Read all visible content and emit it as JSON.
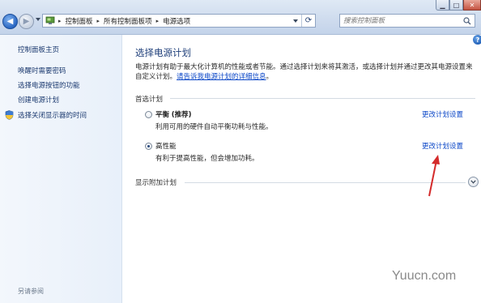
{
  "window": {
    "minimize_icon": "minimize-icon",
    "maximize_icon": "maximize-icon",
    "close_icon": "close-icon"
  },
  "addressbar": {
    "crumbs": [
      "控制面板",
      "所有控制面板项",
      "电源选项"
    ],
    "separator": "▸",
    "refresh_icon": "refresh-icon"
  },
  "search": {
    "placeholder": "搜索控制面板",
    "icon": "search-icon"
  },
  "sidebar": {
    "home": "控制面板主页",
    "links": [
      "唤醒时需要密码",
      "选择电源按钮的功能",
      "创建电源计划",
      "选择关闭显示器的时间"
    ],
    "see_also": "另请参阅"
  },
  "main": {
    "title": "选择电源计划",
    "description_text": "电源计划有助于最大化计算机的性能或者节能。通过选择计划来将其激活，或选择计划并通过更改其电源设置来自定义计划。",
    "description_link": "请告诉我电源计划的详细信息",
    "description_end": "。",
    "preferred_label": "首选计划",
    "plans": [
      {
        "name": "平衡",
        "tag": "(推荐)",
        "desc": "利用可用的硬件自动平衡功耗与性能。",
        "selected": false,
        "change_link": "更改计划设置"
      },
      {
        "name": "高性能",
        "tag": "",
        "desc": "有利于提高性能，但会增加功耗。",
        "selected": true,
        "change_link": "更改计划设置"
      }
    ],
    "show_more": "显示附加计划"
  },
  "watermark": "Yuucn.com",
  "colors": {
    "link": "#0a46c7",
    "title": "#1f3f7a",
    "annotation_arrow": "#d42b2b"
  }
}
